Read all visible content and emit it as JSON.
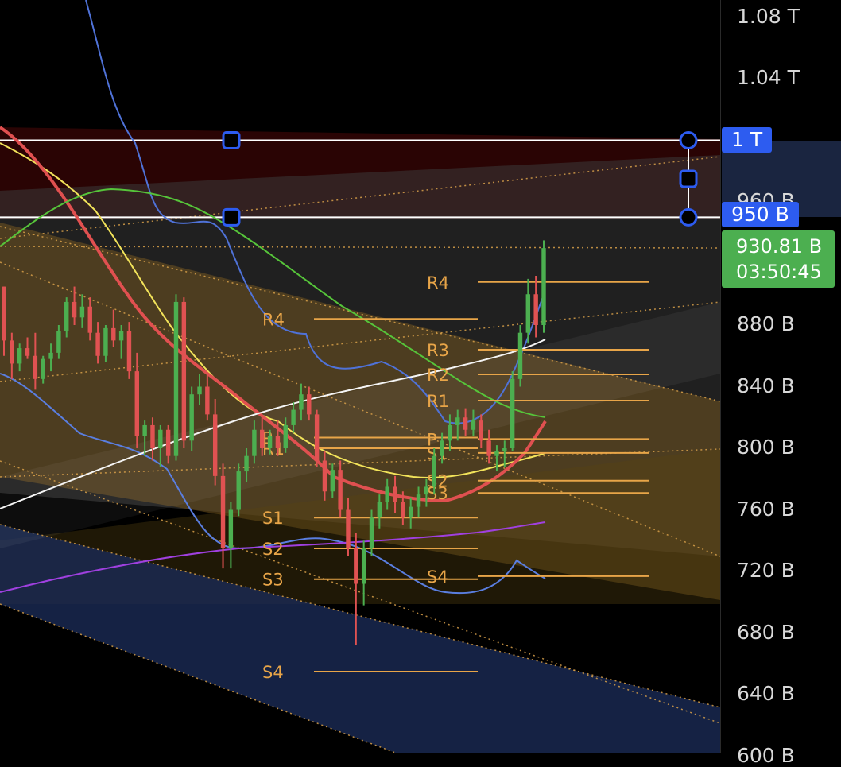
{
  "chart_data": {
    "type": "candlestick",
    "y_unit": "B",
    "ylim": [
      600,
      1100
    ],
    "y_ticks": [
      {
        "value": 1080,
        "label": "1.08 T"
      },
      {
        "value": 1040,
        "label": "1.04 T"
      },
      {
        "value": 880,
        "label": "880 B"
      },
      {
        "value": 840,
        "label": "840 B"
      },
      {
        "value": 800,
        "label": "800 B"
      },
      {
        "value": 760,
        "label": "760 B"
      },
      {
        "value": 720,
        "label": "720 B"
      },
      {
        "value": 680,
        "label": "680 B"
      },
      {
        "value": 640,
        "label": "640 B"
      },
      {
        "value": 600,
        "label": "600 B"
      },
      {
        "value": 960,
        "label": "960 B"
      }
    ],
    "range_box": {
      "top": 1000,
      "bottom": 950,
      "top_label": "1 T",
      "bottom_label": "950 B"
    },
    "last_price": {
      "value": 930.81,
      "label": "930.81 B",
      "countdown": "03:50:45"
    },
    "pivots": [
      {
        "levels": {
          "R4": 884,
          "P": 807,
          "R1": 800,
          "S1": 755,
          "S2": 735,
          "S3": 715,
          "S4": 655
        },
        "visible_labels": [
          "R4",
          "P",
          "R1",
          "S1",
          "S2",
          "S3",
          "S4"
        ]
      },
      {
        "levels": {
          "R4": 908,
          "R3": 864,
          "R2": 848,
          "R1": 831,
          "P": 806,
          "S1": 797,
          "S2": 779,
          "S3": 771,
          "S4": 717
        },
        "visible_labels": [
          "R4",
          "R3",
          "R2",
          "R1",
          "S1",
          "S2",
          "P",
          "S3",
          "S4"
        ]
      }
    ],
    "candles": [
      [
        905,
        905,
        860,
        870
      ],
      [
        870,
        875,
        845,
        855
      ],
      [
        855,
        868,
        850,
        865
      ],
      [
        865,
        872,
        858,
        860
      ],
      [
        860,
        875,
        838,
        845
      ],
      [
        845,
        860,
        842,
        858
      ],
      [
        858,
        868,
        850,
        862
      ],
      [
        862,
        880,
        858,
        876
      ],
      [
        876,
        898,
        872,
        895
      ],
      [
        895,
        905,
        880,
        885
      ],
      [
        885,
        900,
        878,
        892
      ],
      [
        892,
        898,
        870,
        875
      ],
      [
        875,
        882,
        855,
        860
      ],
      [
        860,
        880,
        856,
        878
      ],
      [
        878,
        890,
        866,
        870
      ],
      [
        870,
        880,
        858,
        876
      ],
      [
        876,
        882,
        845,
        850
      ],
      [
        850,
        862,
        800,
        808
      ],
      [
        808,
        818,
        795,
        815
      ],
      [
        815,
        820,
        792,
        800
      ],
      [
        800,
        815,
        788,
        812
      ],
      [
        812,
        815,
        790,
        795
      ],
      [
        795,
        900,
        792,
        895
      ],
      [
        895,
        898,
        800,
        805
      ],
      [
        805,
        840,
        798,
        835
      ],
      [
        835,
        848,
        828,
        840
      ],
      [
        840,
        848,
        818,
        822
      ],
      [
        822,
        832,
        776,
        782
      ],
      [
        782,
        790,
        722,
        735
      ],
      [
        735,
        765,
        722,
        760
      ],
      [
        760,
        790,
        756,
        785
      ],
      [
        785,
        800,
        778,
        795
      ],
      [
        795,
        818,
        790,
        812
      ],
      [
        812,
        820,
        795,
        800
      ],
      [
        800,
        812,
        796,
        808
      ],
      [
        808,
        818,
        795,
        800
      ],
      [
        800,
        820,
        797,
        815
      ],
      [
        815,
        830,
        810,
        825
      ],
      [
        825,
        842,
        818,
        835
      ],
      [
        835,
        840,
        818,
        822
      ],
      [
        822,
        825,
        788,
        792
      ],
      [
        792,
        798,
        766,
        772
      ],
      [
        772,
        790,
        768,
        786
      ],
      [
        786,
        792,
        755,
        760
      ],
      [
        760,
        768,
        730,
        735
      ],
      [
        735,
        745,
        672,
        712
      ],
      [
        712,
        740,
        698,
        735
      ],
      [
        735,
        760,
        730,
        755
      ],
      [
        755,
        770,
        748,
        765
      ],
      [
        765,
        780,
        760,
        775
      ],
      [
        775,
        782,
        758,
        765
      ],
      [
        765,
        772,
        750,
        755
      ],
      [
        755,
        768,
        748,
        762
      ],
      [
        762,
        775,
        755,
        770
      ],
      [
        770,
        780,
        762,
        775
      ],
      [
        775,
        800,
        770,
        795
      ],
      [
        795,
        810,
        790,
        805
      ],
      [
        805,
        822,
        798,
        815
      ],
      [
        815,
        825,
        805,
        820
      ],
      [
        820,
        826,
        808,
        812
      ],
      [
        812,
        825,
        808,
        818
      ],
      [
        818,
        822,
        800,
        805
      ],
      [
        805,
        812,
        790,
        795
      ],
      [
        795,
        802,
        785,
        798
      ],
      [
        798,
        805,
        788,
        800
      ],
      [
        800,
        850,
        798,
        845
      ],
      [
        845,
        880,
        840,
        875
      ],
      [
        875,
        910,
        868,
        900
      ],
      [
        900,
        912,
        872,
        880
      ],
      [
        880,
        935,
        875,
        930
      ]
    ]
  }
}
